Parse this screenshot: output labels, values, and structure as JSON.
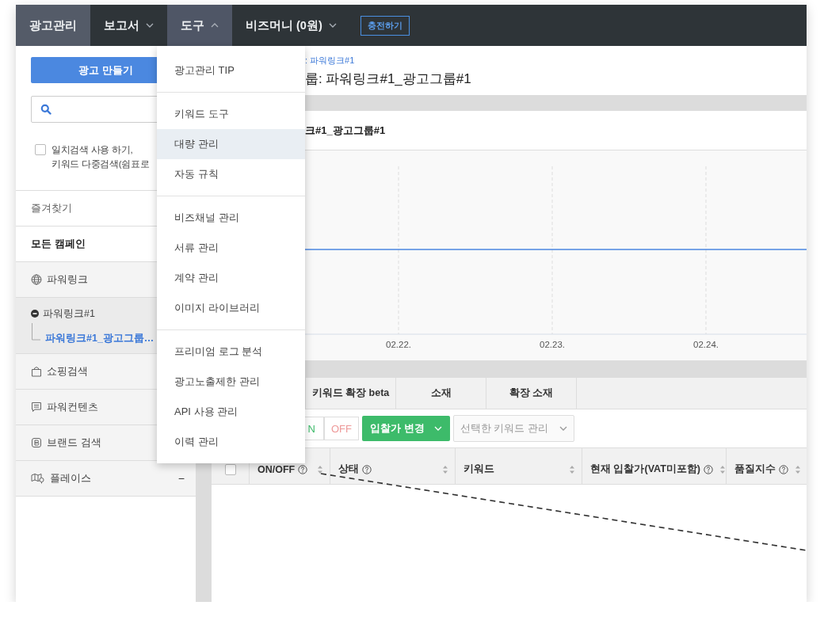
{
  "nav": {
    "items": [
      {
        "label": "광고관리",
        "selected": true
      },
      {
        "label": "보고서",
        "selected": false,
        "expanded": false
      },
      {
        "label": "도구",
        "selected": false,
        "expanded": true
      },
      {
        "label": "비즈머니 (0원)",
        "selected": false,
        "expanded": false
      }
    ],
    "charge_button": "충전하기"
  },
  "tools_menu": {
    "groups": [
      [
        {
          "label": "광고관리 TIP",
          "selected": false
        }
      ],
      [
        {
          "label": "키워드 도구",
          "selected": false
        },
        {
          "label": "대량 관리",
          "selected": true
        },
        {
          "label": "자동 규칙",
          "selected": false
        }
      ],
      [
        {
          "label": "비즈채널 관리",
          "selected": false
        },
        {
          "label": "서류 관리",
          "selected": false
        },
        {
          "label": "계약 관리",
          "selected": false
        },
        {
          "label": "이미지 라이브러리",
          "selected": false
        }
      ],
      [
        {
          "label": "프리미엄 로그 분석",
          "selected": false
        },
        {
          "label": "광고노출제한 관리",
          "selected": false
        },
        {
          "label": "API 사용 관리",
          "selected": false
        },
        {
          "label": "이력 관리",
          "selected": false
        }
      ]
    ]
  },
  "sidebar": {
    "create_button": "광고 만들기",
    "exact_match": {
      "checked": false,
      "lines": [
        "일치검색 사용 하기,",
        "키워드 다중검색(쉼표로"
      ]
    },
    "favorites": "즐겨찾기",
    "all_campaigns": "모든 캠페인",
    "campaign_types": [
      {
        "label": "파워링크",
        "expanded": true,
        "children": [
          {
            "label": "파워링크#1",
            "expanded": true,
            "children": [
              {
                "label": "파워링크#1_광고그룹…",
                "selected": true
              }
            ]
          }
        ]
      },
      {
        "label": "쇼핑검색"
      },
      {
        "label": "파워컨텐츠"
      },
      {
        "label": "브랜드 검색"
      },
      {
        "label": "플레이스",
        "toggle": "−"
      }
    ]
  },
  "main": {
    "breadcrumb": ": 파워링크#1",
    "title": "룹: 파워링크#1_광고그룹#1",
    "chart_title": "크#1_광고그룹#1",
    "x_labels": [
      "02.22.",
      "02.23.",
      "02.24."
    ],
    "tabs": [
      {
        "label": "키워드 확장 beta",
        "selected": false
      },
      {
        "label": "소재",
        "selected": false
      },
      {
        "label": "확장 소재",
        "selected": false
      }
    ],
    "toolbar": {
      "on_button": "N",
      "off_button": "OFF",
      "bid_button": "입찰가 변경",
      "keyword_select": {
        "value": "선택한 키워드 관리",
        "disabled": true
      }
    },
    "table": {
      "select_all": {
        "checked": false
      },
      "columns": [
        {
          "label": "ON/OFF",
          "help": true
        },
        {
          "label": "상태",
          "help": true
        },
        {
          "label": "키워드",
          "help": false
        },
        {
          "label": "현재 입찰가(VAT미포함)",
          "help": true
        },
        {
          "label": "품질지수",
          "help": true
        }
      ]
    }
  }
}
